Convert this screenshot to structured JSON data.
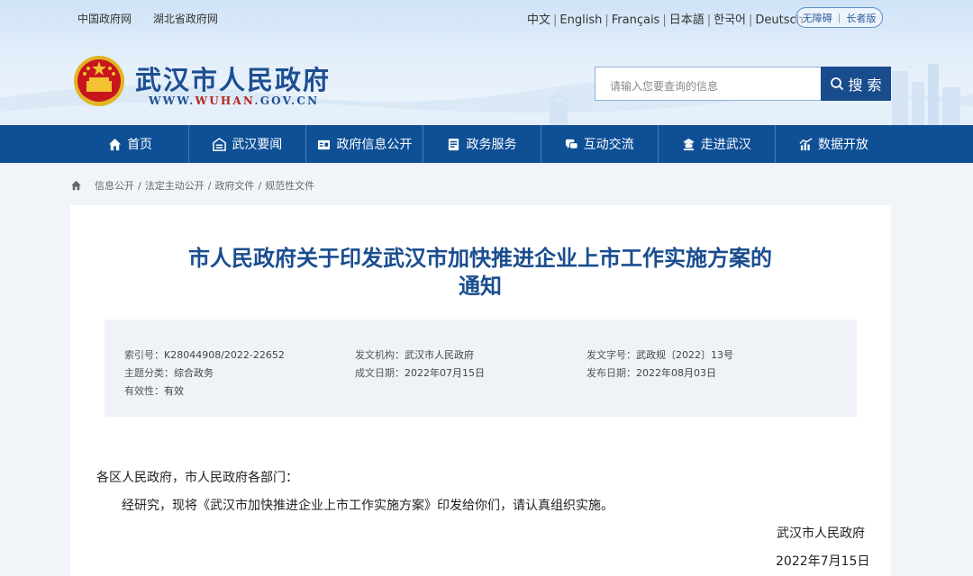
{
  "header": {
    "top_links": [
      "中国政府网",
      "湖北省政府网"
    ],
    "languages": [
      "中文",
      "English",
      "Français",
      "日本語",
      "한국어",
      "Deutsch"
    ],
    "accessibility": [
      "无障碍",
      "长者版"
    ],
    "site_title": "武汉市人民政府",
    "domain_prefix": "WWW.",
    "domain_highlight": "WUHAN",
    "domain_suffix": ".GOV.CN",
    "search_placeholder": "请输入您要查询的信息",
    "search_button": "搜 索"
  },
  "nav": {
    "items": [
      {
        "label": "首页",
        "icon": "home-icon"
      },
      {
        "label": "武汉要闻",
        "icon": "news-icon"
      },
      {
        "label": "政府信息公开",
        "icon": "info-card-icon"
      },
      {
        "label": "政务服务",
        "icon": "service-icon"
      },
      {
        "label": "互动交流",
        "icon": "chat-icon"
      },
      {
        "label": "走进武汉",
        "icon": "pavilion-icon"
      },
      {
        "label": "数据开放",
        "icon": "data-icon"
      }
    ]
  },
  "breadcrumb": [
    "信息公开",
    "法定主动公开",
    "政府文件",
    "规范性文件"
  ],
  "document": {
    "title_line1": "市人民政府关于印发武汉市加快推进企业上市工作实施方案的",
    "title_line2": "通知",
    "meta": {
      "index_label": "索引号：",
      "index_value": "K28044908/2022-22652",
      "topic_label": "主题分类：",
      "topic_value": "综合政务",
      "validity_label": "有效性：",
      "validity_value": "有效",
      "issuer_label": "发文机构：",
      "issuer_value": "武汉市人民政府",
      "created_label": "成文日期：",
      "created_value": "2022年07月15日",
      "docno_label": "发文字号：",
      "docno_value": "武政规〔2022〕13号",
      "published_label": "发布日期：",
      "published_value": "2022年08月03日"
    },
    "salutation": "各区人民政府，市人民政府各部门：",
    "paragraph": "经研究，现将《武汉市加快推进企业上市工作实施方案》印发给你们，请认真组织实施。",
    "signature": "武汉市人民政府",
    "date": "2022年7月15日"
  },
  "colors": {
    "nav_bg": "#0e4f96",
    "title_blue": "#1a4d8f",
    "emblem_red": "#c8161d",
    "emblem_gold": "#f2c230"
  }
}
